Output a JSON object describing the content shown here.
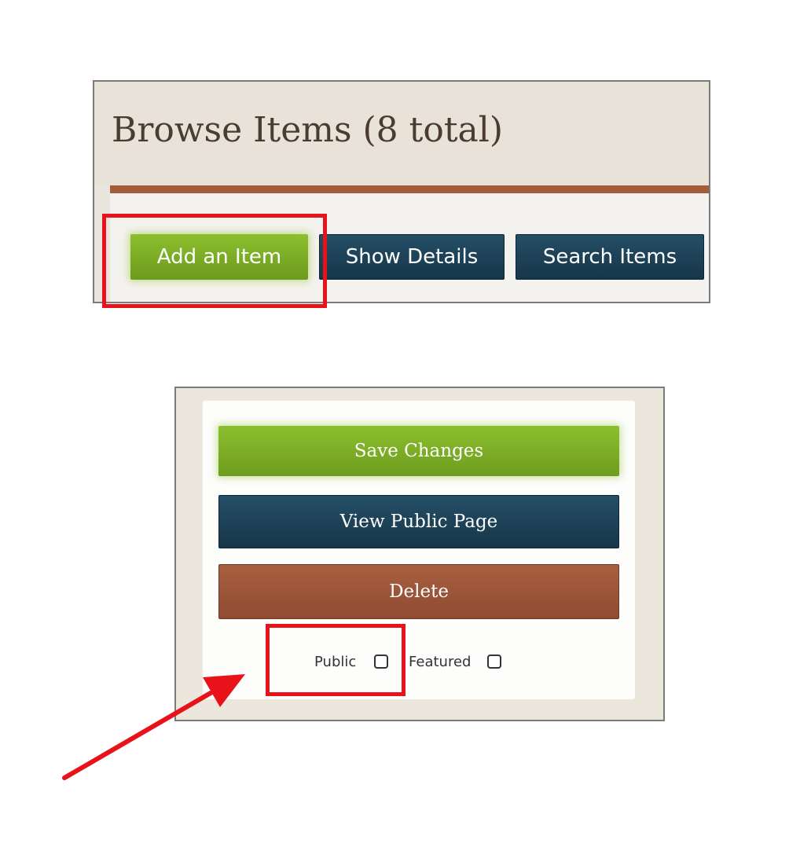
{
  "browse": {
    "title": "Browse Items (8 total)",
    "buttons": {
      "add_item": "Add an Item",
      "show_details": "Show Details",
      "search_items": "Search Items"
    }
  },
  "edit_panel": {
    "buttons": {
      "save_changes": "Save Changes",
      "view_public_page": "View Public Page",
      "delete": "Delete"
    },
    "checkboxes": {
      "public_label": "Public",
      "public_checked": false,
      "featured_label": "Featured",
      "featured_checked": false
    }
  },
  "annotations": {
    "highlight_color": "#e8131a",
    "arrow_icon": "red-arrow-icon"
  },
  "colors": {
    "green": "#7aae26",
    "navy": "#1d4257",
    "rust": "#9c5638",
    "title_brown": "#4a3b33"
  }
}
